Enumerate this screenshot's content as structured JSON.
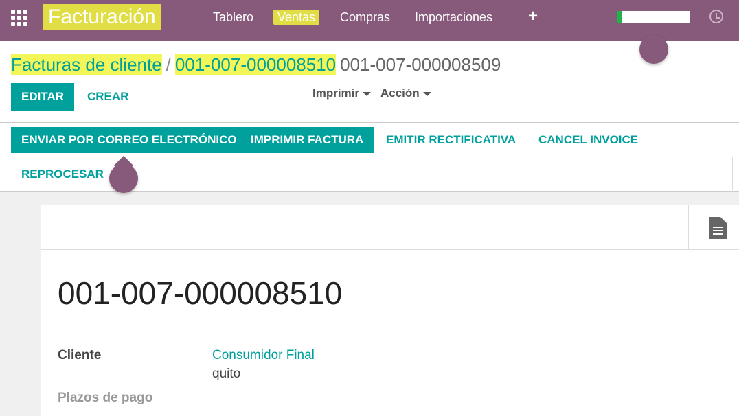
{
  "navbar": {
    "app_title": "Facturación",
    "menus": [
      "Tablero",
      "Ventas",
      "Compras",
      "Importaciones"
    ],
    "add_label": "+",
    "user_name": ""
  },
  "breadcrumb": {
    "parent": "Facturas de cliente",
    "current_link": "001-007-000008510",
    "current": "001-007-000008509"
  },
  "toolbar": {
    "edit": "EDITAR",
    "create": "CREAR",
    "print": "Imprimir",
    "action": "Acción"
  },
  "statusbar": {
    "buttons": [
      "ENVIAR POR CORREO ELECTRÓNICO",
      "IMPRIMIR FACTURA",
      "EMITIR RECTIFICATIVA",
      "CANCEL INVOICE",
      "REPROCESAR"
    ]
  },
  "invoice": {
    "number": "001-007-000008510",
    "customer_label": "Cliente",
    "customer_name": "Consumidor Final",
    "customer_city": "quito",
    "payment_terms_label": "Plazos de pago"
  },
  "colors": {
    "navbar": "#875a7b",
    "accent": "#00a09d",
    "highlight": "#f0f53c"
  },
  "icons": [
    "apps-grid-icon",
    "plus-icon",
    "clock-icon",
    "document-icon",
    "caret-down-icon"
  ]
}
